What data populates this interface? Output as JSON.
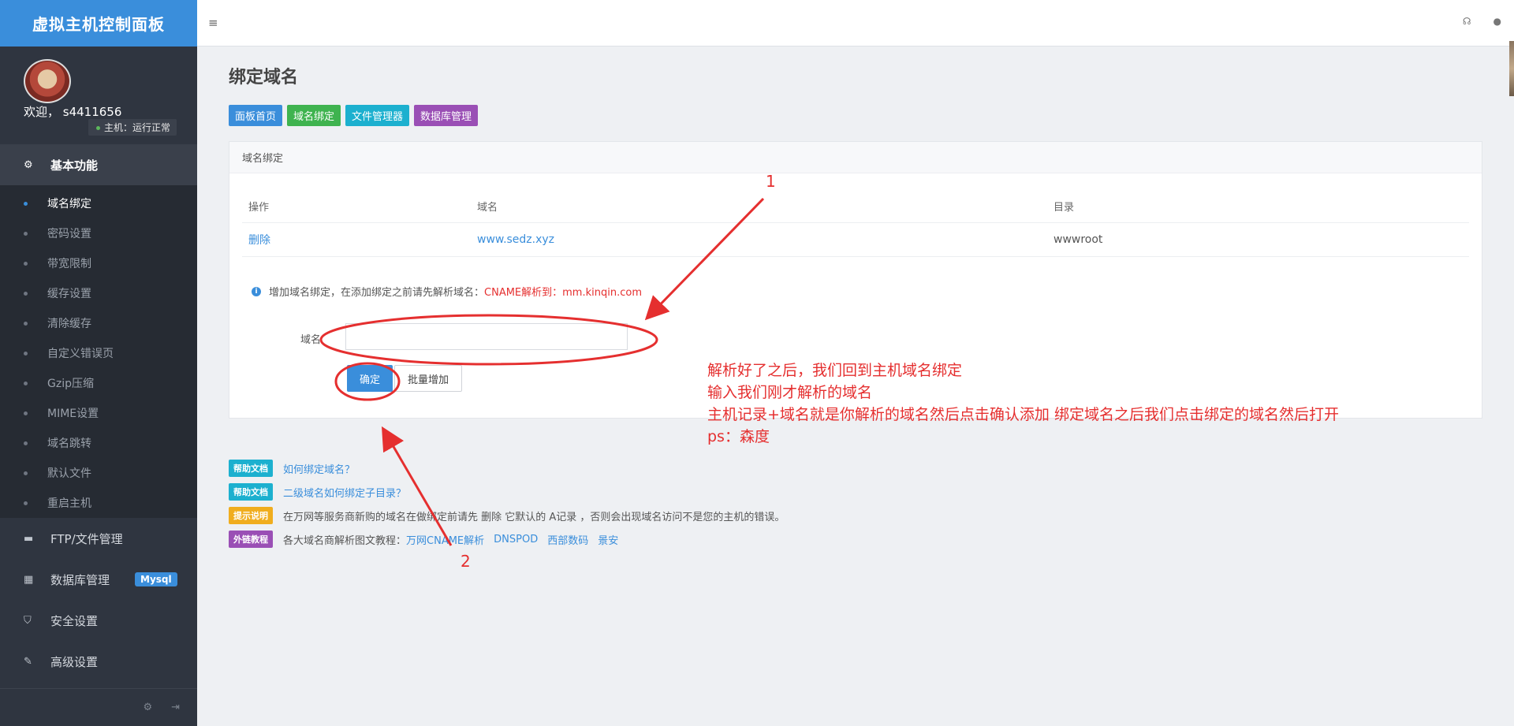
{
  "sidebar": {
    "brand": "虚拟主机控制面板",
    "welcome": "欢迎， s4411656",
    "host_status": "主机：运行正常",
    "section_basic": "基本功能",
    "sub_items": [
      "域名绑定",
      "密码设置",
      "带宽限制",
      "缓存设置",
      "清除缓存",
      "自定义错误页",
      "Gzip压缩",
      "MIME设置",
      "域名跳转",
      "默认文件",
      "重启主机"
    ],
    "nav_ftp": "FTP/文件管理",
    "nav_db": "数据库管理",
    "nav_db_badge": "Mysql",
    "nav_security": "安全设置",
    "nav_advanced": "高级设置"
  },
  "main": {
    "title": "绑定域名",
    "quick_links": [
      "面板首页",
      "域名绑定",
      "文件管理器",
      "数据库管理"
    ],
    "panel_title": "域名绑定",
    "table": {
      "headers": [
        "操作",
        "域名",
        "目录"
      ],
      "rows": [
        {
          "action": "删除",
          "domain": "www.sedz.xyz",
          "dir": "wwwroot"
        }
      ]
    },
    "tip_prefix": "增加域名绑定，在添加绑定之前请先解析域名：",
    "tip_red": "CNAME解析到：mm.kinqin.com",
    "field_label": "域名",
    "input_value": "",
    "btn_confirm": "确定",
    "btn_batch": "批量增加"
  },
  "help": {
    "row1_badge": "帮助文档",
    "row1_link": "如何绑定域名？",
    "row2_badge": "帮助文档",
    "row2_link": "二级域名如何绑定子目录？",
    "row3_badge": "提示说明",
    "row3_text": "在万网等服务商新购的域名在做绑定前请先 删除 它默认的 A记录 ，否则会出现域名访问不是您的主机的错误。",
    "row4_badge": "外链教程",
    "row4_text": "各大域名商解析图文教程：",
    "row4_links": [
      "万网CNAME解析",
      "DNSPOD",
      "西部数码",
      "景安"
    ]
  },
  "annotations": {
    "num1": "1",
    "num2": "2",
    "lines": [
      "解析好了之后，我们回到主机域名绑定",
      "输入我们刚才解析的域名",
      "主机记录+域名就是你解析的域名然后点击确认添加 绑定域名之后我们点击绑定的域名然后打开",
      "ps：森度"
    ]
  }
}
